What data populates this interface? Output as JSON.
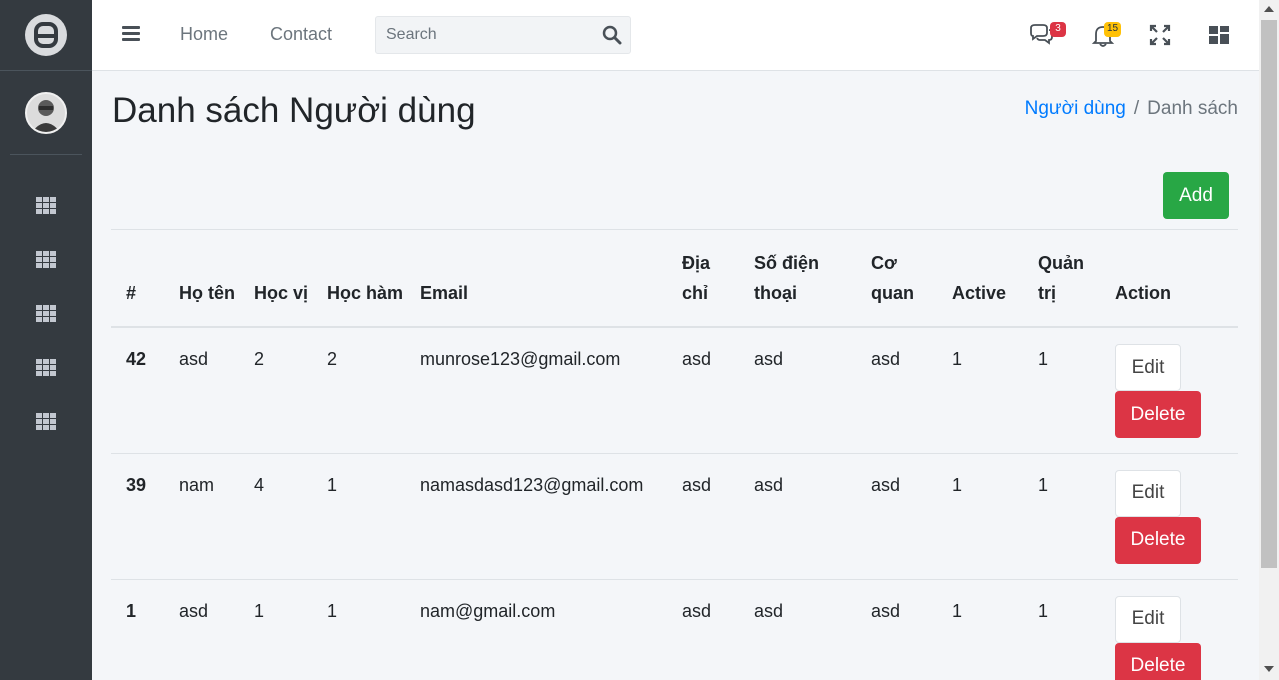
{
  "navbar": {
    "links": [
      "Home",
      "Contact"
    ],
    "search_placeholder": "Search",
    "messages_count": "3",
    "notifications_count": "15"
  },
  "sidebar": {
    "items": [
      {
        "icon": "grid-icon"
      },
      {
        "icon": "grid-icon"
      },
      {
        "icon": "grid-icon"
      },
      {
        "icon": "grid-icon"
      },
      {
        "icon": "grid-icon"
      }
    ]
  },
  "page": {
    "title": "Danh sách Người dùng",
    "breadcrumb": [
      "Người dùng",
      "Danh sách"
    ],
    "add_label": "Add"
  },
  "table": {
    "headers": [
      "#",
      "Họ tên",
      "Học vị",
      "Học hàm",
      "Email",
      "Địa chỉ",
      "Số điện thoại",
      "Cơ quan",
      "Active",
      "Quản trị",
      "Action"
    ],
    "edit_label": "Edit",
    "delete_label": "Delete",
    "rows": [
      [
        "42",
        "asd",
        "2",
        "2",
        "munrose123@gmail.com",
        "asd",
        "asd",
        "asd",
        "1",
        "1"
      ],
      [
        "39",
        "nam",
        "4",
        "1",
        "namasdasd123@gmail.com",
        "asd",
        "asd",
        "asd",
        "1",
        "1"
      ],
      [
        "1",
        "asd",
        "1",
        "1",
        "nam@gmail.com",
        "asd",
        "asd",
        "asd",
        "1",
        "1"
      ]
    ]
  },
  "colors": {
    "sidebar_bg": "#343a40",
    "primary": "#007bff",
    "success": "#28a745",
    "danger": "#dc3545",
    "warning": "#ffc107"
  }
}
